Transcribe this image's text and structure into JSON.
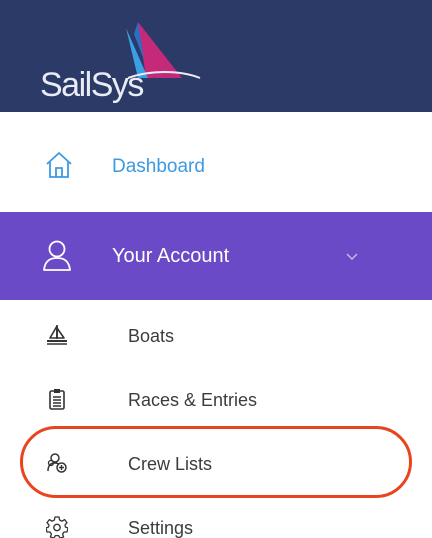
{
  "brand": {
    "name": "SailSys",
    "colors": {
      "header_bg": "#2b3a67",
      "sail_blue": "#3aa0e6",
      "sail_magenta": "#c42a78",
      "accent_purple": "#6b4ac7",
      "active_link": "#3d9ae0",
      "highlight_ring": "#e8451f"
    }
  },
  "nav": {
    "dashboard": {
      "label": "Dashboard",
      "icon": "home-icon"
    },
    "account": {
      "label": "Your Account",
      "icon": "user-icon",
      "expanded": true,
      "chevron_icon": "chevron-down-icon"
    },
    "sub_items": [
      {
        "label": "Boats",
        "icon": "sailboat-icon"
      },
      {
        "label": "Races & Entries",
        "icon": "clipboard-icon"
      },
      {
        "label": "Crew Lists",
        "icon": "crew-icon",
        "highlighted": true
      },
      {
        "label": "Settings",
        "icon": "gear-icon"
      }
    ]
  }
}
